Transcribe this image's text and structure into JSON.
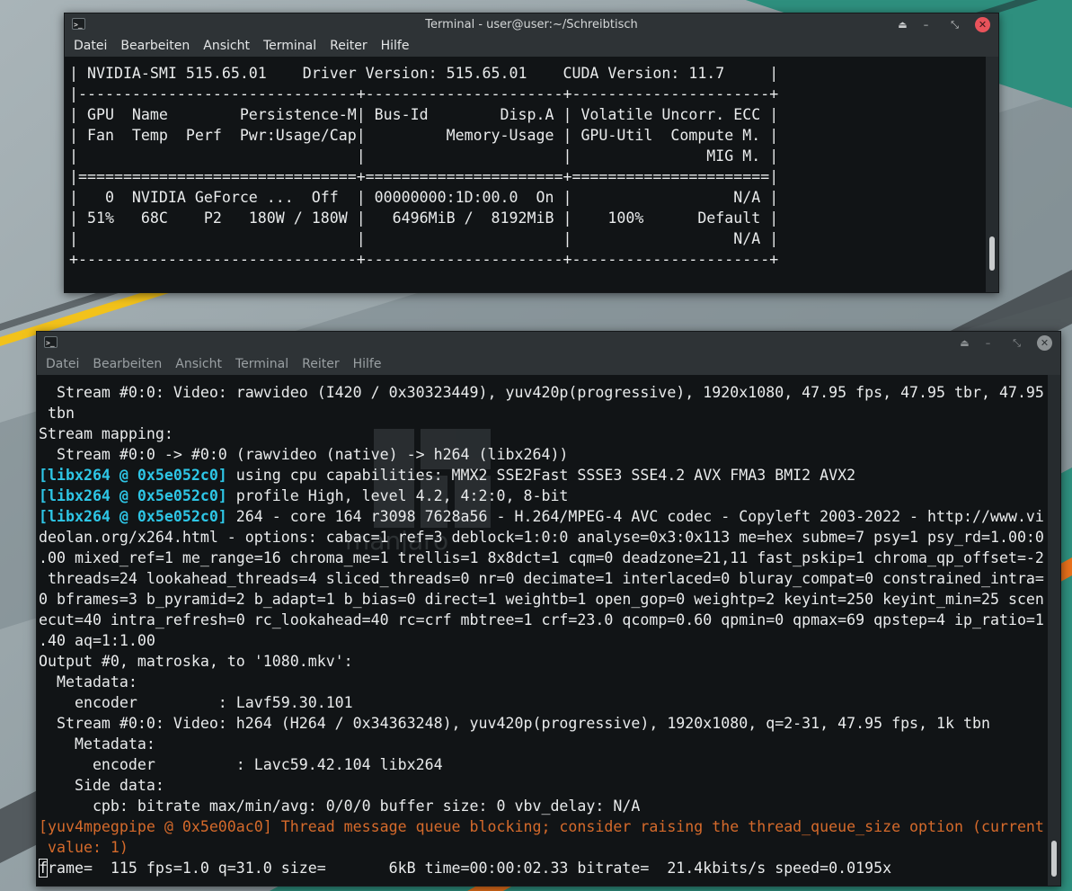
{
  "window_top": {
    "title": "Terminal - user@user:~/Schreibtisch",
    "menu": [
      "Datei",
      "Bearbeiten",
      "Ansicht",
      "Terminal",
      "Reiter",
      "Hilfe"
    ],
    "controls": {
      "pin": "⏏",
      "minimize": "–",
      "maximize": "⤡",
      "close": "✕"
    },
    "lines": [
      "| NVIDIA-SMI 515.65.01    Driver Version: 515.65.01    CUDA Version: 11.7     |",
      "|-------------------------------+----------------------+----------------------+",
      "| GPU  Name        Persistence-M| Bus-Id        Disp.A | Volatile Uncorr. ECC |",
      "| Fan  Temp  Perf  Pwr:Usage/Cap|         Memory-Usage | GPU-Util  Compute M. |",
      "|                               |                      |               MIG M. |",
      "|===============================+======================+======================|",
      "|   0  NVIDIA GeForce ...  Off  | 00000000:1D:00.0  On |                  N/A |",
      "| 51%   68C    P2   180W / 180W |   6496MiB /  8192MiB |    100%      Default |",
      "|                               |                      |                  N/A |",
      "+-------------------------------+----------------------+----------------------+"
    ]
  },
  "window_bottom": {
    "menu": [
      "Datei",
      "Bearbeiten",
      "Ansicht",
      "Terminal",
      "Reiter",
      "Hilfe"
    ],
    "controls": {
      "pin": "⏏",
      "minimize": "–",
      "maximize": "⤡",
      "close": "✕"
    },
    "lines": [
      {
        "text": "  Stream #0:0: Video: rawvideo (I420 / 0x30323449), yuv420p(progressive), 1920x1080, 47.95 fps, 47.95 tbr, 47.95"
      },
      {
        "text": " tbn"
      },
      {
        "text": "Stream mapping:"
      },
      {
        "text": "  Stream #0:0 -> #0:0 (rawvideo (native) -> h264 (libx264))"
      },
      {
        "prefix": "[libx264 @ 0x5e052c0]",
        "text": " using cpu capabilities: MMX2 SSE2Fast SSSE3 SSE4.2 AVX FMA3 BMI2 AVX2"
      },
      {
        "prefix": "[libx264 @ 0x5e052c0]",
        "text": " profile High, level 4.2, 4:2:0, 8-bit"
      },
      {
        "prefix": "[libx264 @ 0x5e052c0]",
        "text": " 264 - core 164 r3098 7628a56 - H.264/MPEG-4 AVC codec - Copyleft 2003-2022 - http://www.vi"
      },
      {
        "text": "deolan.org/x264.html - options: cabac=1 ref=3 deblock=1:0:0 analyse=0x3:0x113 me=hex subme=7 psy=1 psy_rd=1.00:0"
      },
      {
        "text": ".00 mixed_ref=1 me_range=16 chroma_me=1 trellis=1 8x8dct=1 cqm=0 deadzone=21,11 fast_pskip=1 chroma_qp_offset=-2"
      },
      {
        "text": " threads=24 lookahead_threads=4 sliced_threads=0 nr=0 decimate=1 interlaced=0 bluray_compat=0 constrained_intra="
      },
      {
        "text": "0 bframes=3 b_pyramid=2 b_adapt=1 b_bias=0 direct=1 weightb=1 open_gop=0 weightp=2 keyint=250 keyint_min=25 scen"
      },
      {
        "text": "ecut=40 intra_refresh=0 rc_lookahead=40 rc=crf mbtree=1 crf=23.0 qcomp=0.60 qpmin=0 qpmax=69 qpstep=4 ip_ratio=1"
      },
      {
        "text": ".40 aq=1:1.00"
      },
      {
        "text": "Output #0, matroska, to '1080.mkv':"
      },
      {
        "text": "  Metadata:"
      },
      {
        "text": "    encoder         : Lavf59.30.101"
      },
      {
        "text": "  Stream #0:0: Video: h264 (H264 / 0x34363248), yuv420p(progressive), 1920x1080, q=2-31, 47.95 fps, 1k tbn"
      },
      {
        "text": "    Metadata:"
      },
      {
        "text": "      encoder         : Lavc59.42.104 libx264"
      },
      {
        "text": "    Side data:"
      },
      {
        "text": "      cpb: bitrate max/min/avg: 0/0/0 buffer size: 0 vbv_delay: N/A"
      },
      {
        "warn": "[yuv4mpegpipe @ 0x5e00ac0] Thread message queue blocking; consider raising the thread_queue_size option (current"
      },
      {
        "warn": " value: 1)"
      },
      {
        "cursor": true,
        "text": "frame=  115 fps=1.0 q=31.0 size=       6kB time=00:00:02.33 bitrate=  21.4kbits/s speed=0.0195x"
      }
    ]
  },
  "colors": {
    "wallpaper_teal": "#2e8f7e",
    "wallpaper_yellow": "#f2c21b",
    "wallpaper_orange": "#e8711c",
    "libx264_prefix": "#2ec6e6",
    "warning": "#d56a2b",
    "close_button": "#e9535b"
  },
  "watermark": "manjaro"
}
